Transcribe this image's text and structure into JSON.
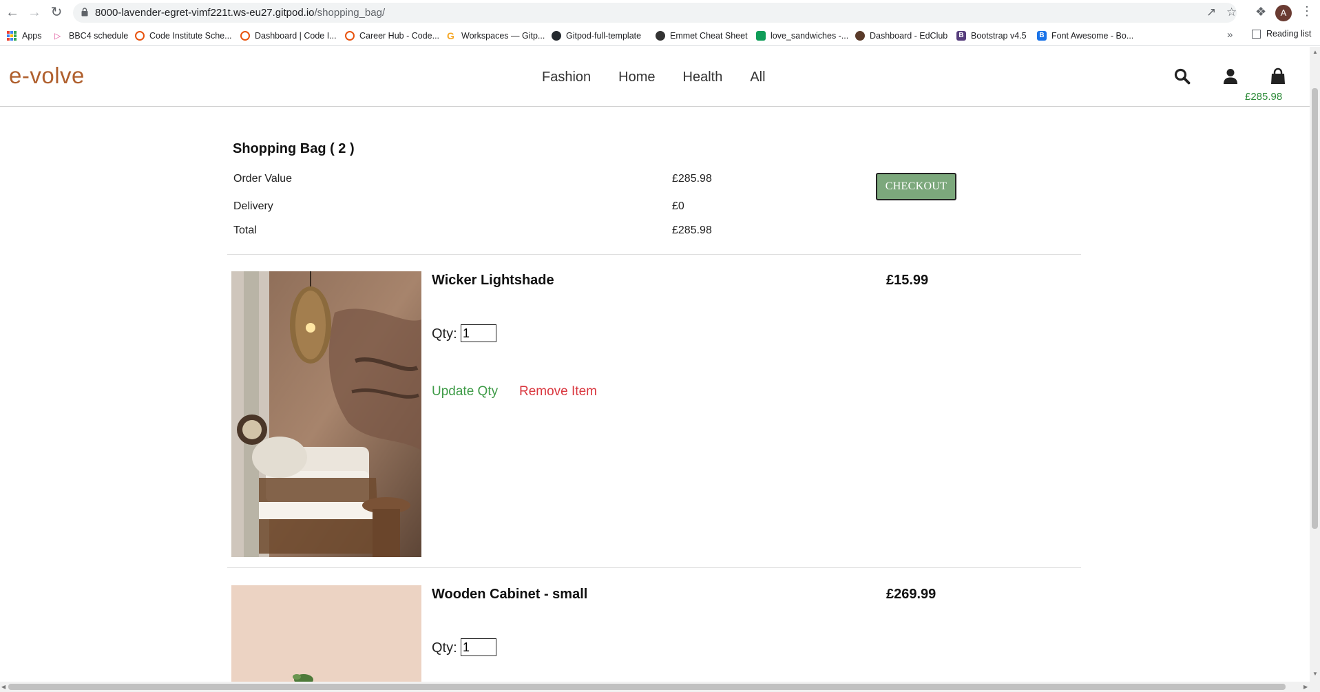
{
  "browser": {
    "url_host": "8000-lavender-egret-vimf221t.ws-eu27.gitpod.io",
    "url_path": "/shopping_bag/",
    "avatar_letter": "A",
    "bookmarks": [
      {
        "label": "Apps",
        "icon": "apps-grid-icon",
        "color": "#ea4335"
      },
      {
        "label": "BBC4 schedule",
        "icon": "play-icon",
        "color": "#e0569d"
      },
      {
        "label": "Code Institute Sche...",
        "icon": "ring-icon",
        "color": "#e8530e"
      },
      {
        "label": "Dashboard | Code I...",
        "icon": "ring-icon",
        "color": "#e8530e"
      },
      {
        "label": "Career Hub - Code...",
        "icon": "ring-icon",
        "color": "#e8530e"
      },
      {
        "label": "Workspaces — Gitp...",
        "icon": "gitpod-icon",
        "color": "#f5a623"
      },
      {
        "label": "Gitpod-full-template",
        "icon": "github-icon",
        "color": "#24292e"
      },
      {
        "label": "Emmet Cheat Sheet",
        "icon": "emmet-icon",
        "color": "#333333"
      },
      {
        "label": "love_sandwiches -...",
        "icon": "sheets-icon",
        "color": "#0f9d58"
      },
      {
        "label": "Dashboard - EdClub",
        "icon": "edclub-icon",
        "color": "#5a3b2a"
      },
      {
        "label": "Bootstrap v4.5",
        "icon": "bootstrap-icon",
        "color": "#563d7c"
      },
      {
        "label": "Font Awesome - Bo...",
        "icon": "fontawesome-icon",
        "color": "#1a73e8"
      }
    ],
    "reading_list": "Reading list"
  },
  "header": {
    "logo": "e-volve",
    "nav": [
      "Fashion",
      "Home",
      "Health",
      "All"
    ],
    "bag_total": "£285.98",
    "accent_color": "#b0602e",
    "bag_total_color": "#2e8b3a"
  },
  "bag": {
    "title": "Shopping Bag ( 2 )",
    "summary": [
      {
        "label": "Order Value",
        "value": "£285.98"
      },
      {
        "label": "Delivery",
        "value": "£0"
      },
      {
        "label": "Total",
        "value": "£285.98"
      }
    ],
    "checkout_label": "CHECKOUT",
    "checkout_color": "#7ca87c",
    "items": [
      {
        "name": "Wicker Lightshade",
        "price": "£15.99",
        "qty_label": "Qty:",
        "qty": "1",
        "update_label": "Update Qty",
        "remove_label": "Remove Item"
      },
      {
        "name": "Wooden Cabinet - small",
        "price": "£269.99",
        "qty_label": "Qty:",
        "qty": "1"
      }
    ]
  }
}
